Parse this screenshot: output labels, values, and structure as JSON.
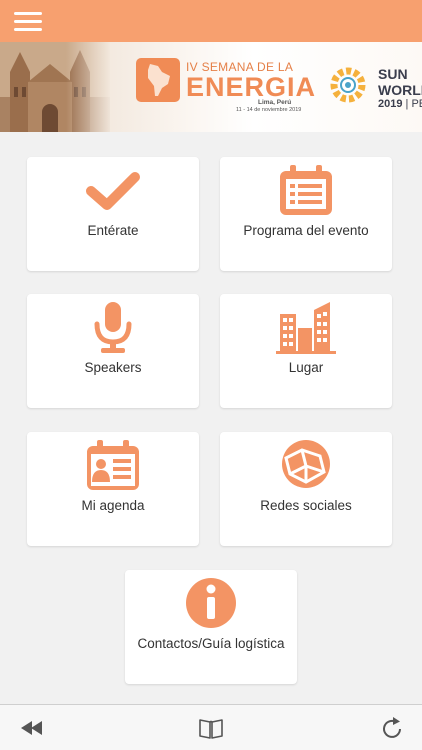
{
  "header": {
    "menu_icon": "hamburger-menu-icon",
    "color": "#f7a06f"
  },
  "banner": {
    "line1": "IV SEMANA DE LA",
    "line2": "ENERGIA",
    "city": "Lima, Perú",
    "dates": "11 - 14 de noviembre 2019",
    "partner_line1": "SUN",
    "partner_line2": "WORLD",
    "partner_year": "2019",
    "partner_suffix": " | PE"
  },
  "tiles": [
    {
      "label": "Entérate",
      "icon": "checkmark-icon"
    },
    {
      "label": "Programa del evento",
      "icon": "calendar-list-icon"
    },
    {
      "label": "Speakers",
      "icon": "microphone-icon"
    },
    {
      "label": "Lugar",
      "icon": "buildings-icon"
    },
    {
      "label": "Mi agenda",
      "icon": "agenda-contact-icon"
    },
    {
      "label": "Redes sociales",
      "icon": "network-globe-icon"
    },
    {
      "label": "Contactos/Guía logística",
      "icon": "info-icon"
    }
  ],
  "bottom_bar": {
    "back_icon": "rewind-back-icon",
    "book_icon": "book-icon",
    "reload_icon": "reload-icon"
  },
  "colors": {
    "accent": "#f7a06f",
    "icon": "#f39464",
    "background": "#f1f1f1"
  }
}
